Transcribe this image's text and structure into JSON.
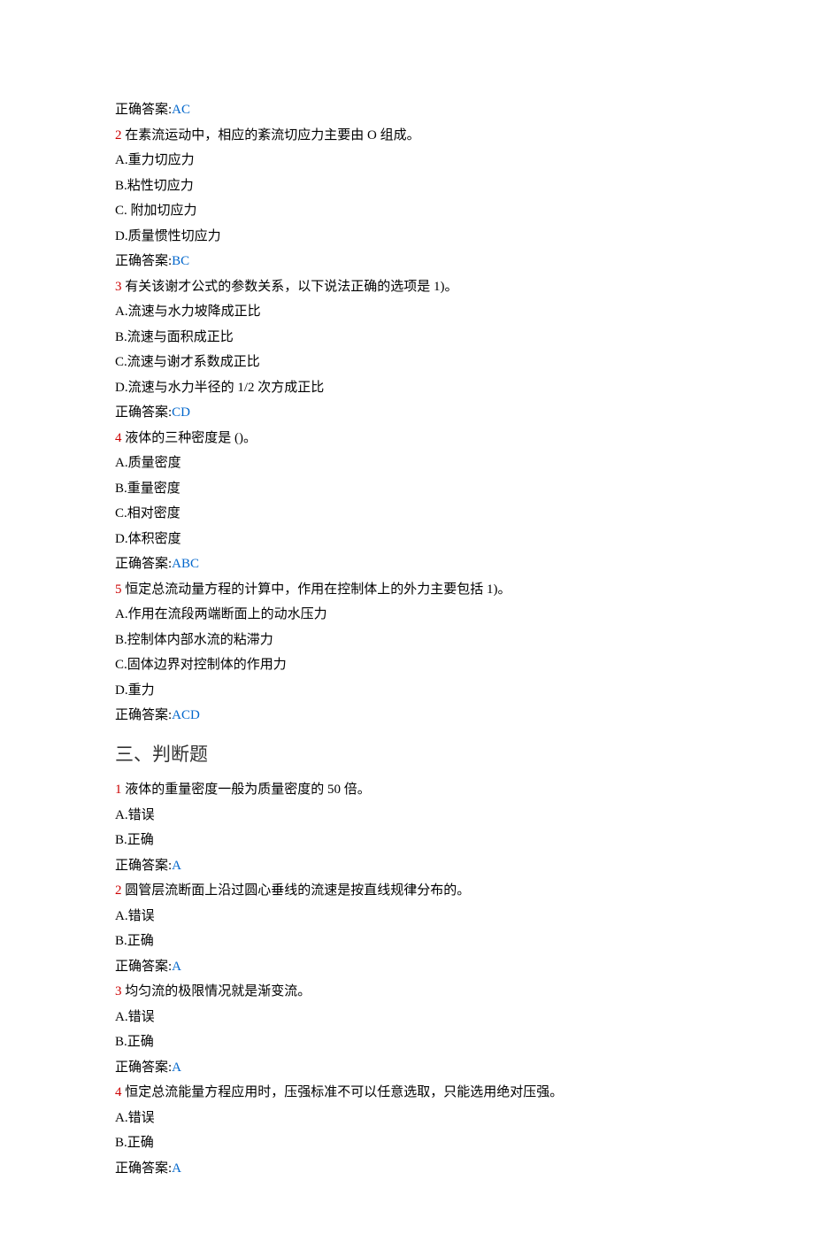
{
  "items": [
    {
      "type": "answer",
      "label": "正确答案:",
      "value": "AC"
    },
    {
      "type": "question",
      "num": "2",
      "text": " 在素流运动中，相应的紊流切应力主要由 O 组成。"
    },
    {
      "type": "plain",
      "text": "A.重力切应力"
    },
    {
      "type": "plain",
      "text": "B.粘性切应力"
    },
    {
      "type": "plain",
      "text": "C. 附加切应力"
    },
    {
      "type": "plain",
      "text": "D.质量惯性切应力"
    },
    {
      "type": "answer",
      "label": "正确答案:",
      "value": "BC"
    },
    {
      "type": "question",
      "num": "3",
      "text": " 有关该谢才公式的参数关系，以下说法正确的选项是 1)。"
    },
    {
      "type": "plain",
      "text": "A.流速与水力坡降成正比"
    },
    {
      "type": "plain",
      "text": "B.流速与面积成正比"
    },
    {
      "type": "plain",
      "text": "C.流速与谢才系数成正比"
    },
    {
      "type": "plain",
      "text": "D.流速与水力半径的 1/2 次方成正比"
    },
    {
      "type": "answer",
      "label": "正确答案:",
      "value": "CD"
    },
    {
      "type": "question",
      "num": "4",
      "text": " 液体的三种密度是 ()。"
    },
    {
      "type": "plain",
      "text": "A.质量密度"
    },
    {
      "type": "plain",
      "text": "B.重量密度"
    },
    {
      "type": "plain",
      "text": "C.相对密度"
    },
    {
      "type": "plain",
      "text": "D.体积密度"
    },
    {
      "type": "answer",
      "label": "正确答案:",
      "value": "ABC"
    },
    {
      "type": "question",
      "num": "5",
      "text": " 恒定总流动量方程的计算中，作用在控制体上的外力主要包括 1)。"
    },
    {
      "type": "plain",
      "text": "A.作用在流段两端断面上的动水压力"
    },
    {
      "type": "plain",
      "text": "B.控制体内部水流的粘滞力"
    },
    {
      "type": "plain",
      "text": "C.固体边界对控制体的作用力"
    },
    {
      "type": "plain",
      "text": "D.重力"
    },
    {
      "type": "answer",
      "label": "正确答案:",
      "value": "ACD"
    },
    {
      "type": "section",
      "text": "三、判断题"
    },
    {
      "type": "question",
      "num": "1",
      "text": " 液体的重量密度一般为质量密度的 50 倍。"
    },
    {
      "type": "plain",
      "text": "A.错误"
    },
    {
      "type": "plain",
      "text": "B.正确"
    },
    {
      "type": "answer",
      "label": "正确答案:",
      "value": "A"
    },
    {
      "type": "question",
      "num": "2",
      "text": " 圆管层流断面上沿过圆心垂线的流速是按直线规律分布的。"
    },
    {
      "type": "plain",
      "text": "A.错误"
    },
    {
      "type": "plain",
      "text": "B.正确"
    },
    {
      "type": "answer",
      "label": "正确答案:",
      "value": "A"
    },
    {
      "type": "question",
      "num": "3",
      "text": " 均匀流的极限情况就是渐变流。"
    },
    {
      "type": "plain",
      "text": "A.错误"
    },
    {
      "type": "plain",
      "text": "B.正确"
    },
    {
      "type": "answer",
      "label": "正确答案:",
      "value": "A"
    },
    {
      "type": "question",
      "num": "4",
      "text": " 恒定总流能量方程应用时，压强标准不可以任意选取，只能选用绝对压强。"
    },
    {
      "type": "plain",
      "text": "A.错误"
    },
    {
      "type": "plain",
      "text": "B.正确"
    },
    {
      "type": "answer",
      "label": "正确答案:",
      "value": "A"
    }
  ]
}
